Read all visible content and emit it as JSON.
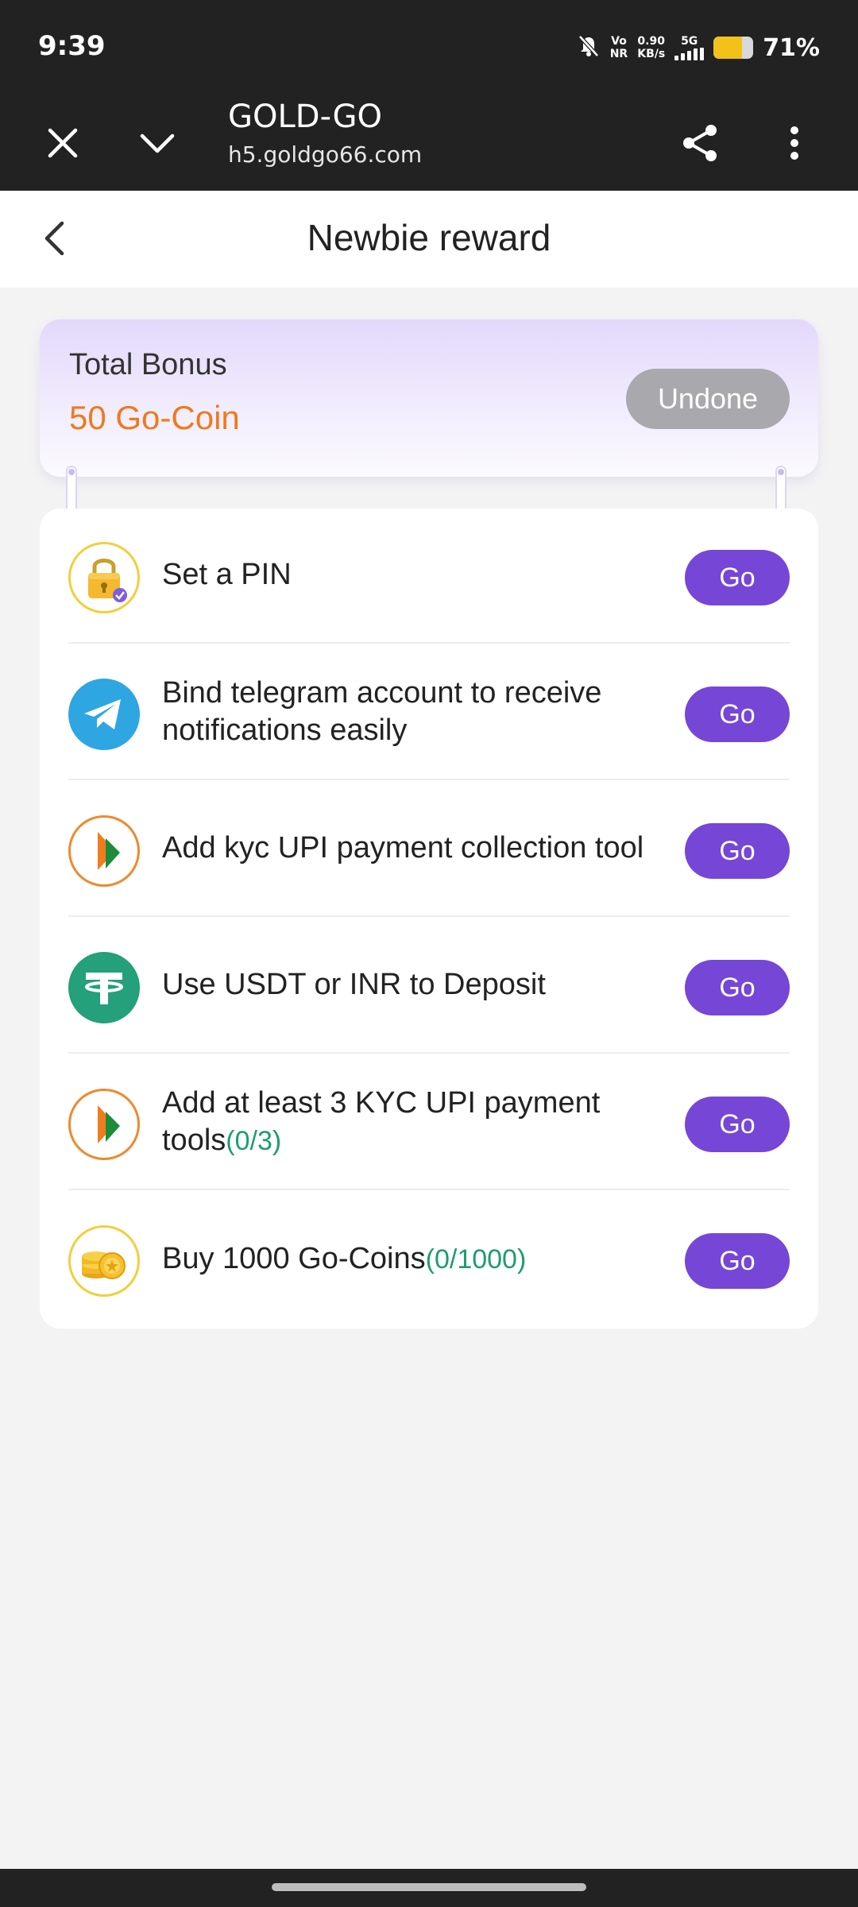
{
  "status_bar": {
    "time": "9:39",
    "network_top": "Vo",
    "network_bottom": "NR",
    "speed_value": "0.90",
    "speed_unit": "KB/s",
    "network_type": "5G",
    "battery_level": 71,
    "battery_text": "71%",
    "icons": [
      "mute-bell-icon",
      "signal-icon",
      "battery-icon"
    ]
  },
  "browser": {
    "title": "GOLD-GO",
    "url": "h5.goldgo66.com",
    "icons": [
      "close-icon",
      "chevron-down-icon",
      "share-icon",
      "more-vert-icon"
    ]
  },
  "header": {
    "title": "Newbie reward",
    "back_icon": "chevron-left-icon"
  },
  "bonus": {
    "label": "Total Bonus",
    "value": "50 Go-Coin",
    "status_button": "Undone"
  },
  "tasks": [
    {
      "icon": "lock-icon",
      "text": "Set a PIN",
      "progress": "",
      "button": "Go"
    },
    {
      "icon": "telegram-icon",
      "text": "Bind telegram account to receive notifications easily",
      "progress": "",
      "button": "Go"
    },
    {
      "icon": "upi-icon",
      "text": "Add kyc UPI payment collection tool",
      "progress": "",
      "button": "Go"
    },
    {
      "icon": "tether-icon",
      "text": "Use USDT or INR to Deposit",
      "progress": "",
      "button": "Go"
    },
    {
      "icon": "upi-icon",
      "text": "Add at least 3 KYC UPI payment tools",
      "progress": "(0/3)",
      "button": "Go"
    },
    {
      "icon": "coins-icon",
      "text": "Buy 1000 Go-Coins",
      "progress": "(0/1000)",
      "button": "Go"
    }
  ],
  "colors": {
    "accent": "#7646d6",
    "bonus_value": "#ee7a1d",
    "progress": "#1f9c6d",
    "undone_button": "#a9a8ad",
    "status_bar_bg": "#222222",
    "page_bg": "#f3f3f4"
  }
}
